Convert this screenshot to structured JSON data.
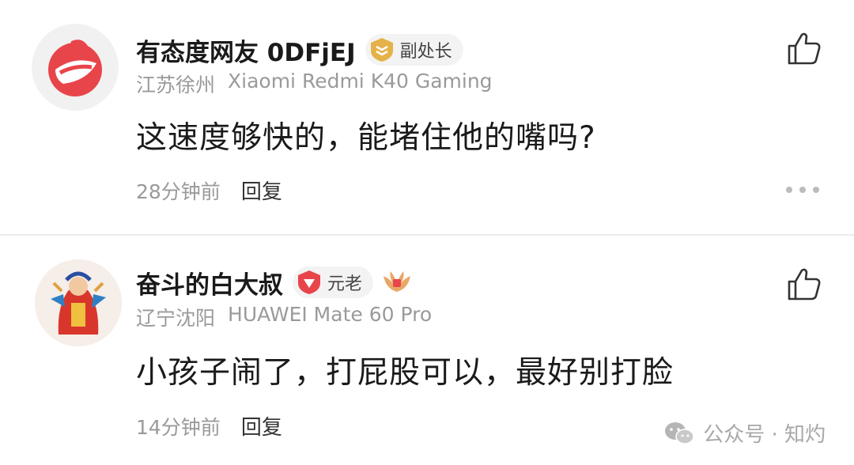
{
  "comments": [
    {
      "username": "有态度网友 0DFjEJ",
      "badge_label": "副处长",
      "location": "江苏徐州",
      "device": "Xiaomi Redmi K40 Gaming",
      "text": "这速度够快的，能堵住他的嘴吗?",
      "time": "28分钟前",
      "reply_label": "回复"
    },
    {
      "username": "奋斗的白大叔",
      "badge_label": "元老",
      "location": "辽宁沈阳",
      "device": "HUAWEI Mate 60 Pro",
      "text": "小孩子闹了，打屁股可以，最好别打脸",
      "time": "14分钟前",
      "reply_label": "回复"
    }
  ],
  "watermark": {
    "label": "公众号 · 知灼"
  },
  "colors": {
    "accent_red": "#e8454b",
    "gold_badge": "#e5b24a",
    "muted_text": "#9a9a9a"
  }
}
